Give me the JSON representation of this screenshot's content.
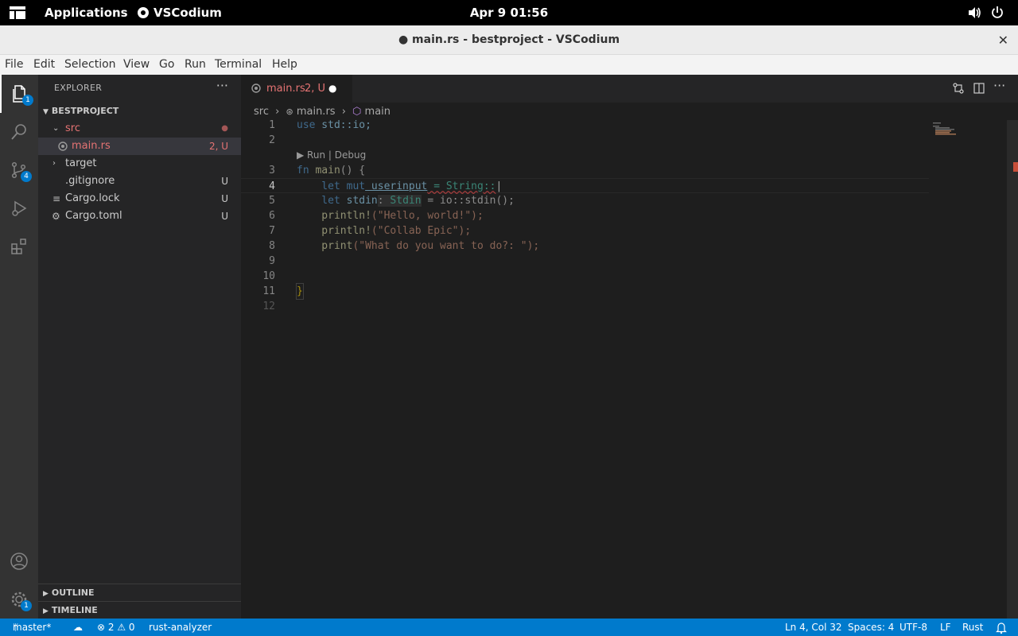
{
  "topbar": {
    "applications": "Applications",
    "app_name": "VSCodium",
    "clock": "Apr 9  01:56"
  },
  "window": {
    "title": "● main.rs - bestproject - VSCodium",
    "close": "✕"
  },
  "menu": [
    "File",
    "Edit",
    "Selection",
    "View",
    "Go",
    "Run",
    "Terminal",
    "Help"
  ],
  "activity": {
    "explorer_badge": "1",
    "scm_badge": "4",
    "settings_badge": "1"
  },
  "sidebar": {
    "title": "EXPLORER",
    "more": "···",
    "project": "BESTPROJECT",
    "tree": [
      {
        "name": "src",
        "status": "●",
        "color": "#e57373"
      },
      {
        "name": "main.rs",
        "status": "2, U",
        "color": "#e57373"
      },
      {
        "name": "target",
        "status": "",
        "color": "#cccccc"
      },
      {
        "name": ".gitignore",
        "status": "U",
        "color": "#cccccc"
      },
      {
        "name": "Cargo.lock",
        "status": "U",
        "color": "#cccccc"
      },
      {
        "name": "Cargo.toml",
        "status": "U",
        "color": "#cccccc"
      }
    ],
    "outline": "OUTLINE",
    "timeline": "TIMELINE"
  },
  "editor": {
    "tab_label": "main.rs",
    "tab_status": "2, U",
    "breadcrumb": {
      "folder": "src",
      "file": "main.rs",
      "symbol": "main"
    },
    "codelens": "▶ Run | Debug",
    "lines": [
      "1",
      "2",
      "3",
      "4",
      "5",
      "6",
      "7",
      "8",
      "9",
      "10",
      "11",
      "12"
    ],
    "code": {
      "l1_kw": "use",
      "l1_rest": " std::io;",
      "l3_kw": "fn",
      "l3_fn": " main",
      "l3_rest": "() {",
      "l4_kw": "    let mut",
      "l4_var": " userinput",
      "l4_rest": " = String::",
      "l5_kw": "    let",
      "l5_var": " stdin",
      "l5_colon": ": ",
      "l5_ty": "Stdin",
      "l5_rest": " = io::stdin();",
      "l6_fn": "    println!",
      "l6_str": "(\"Hello, world!\");",
      "l7_fn": "    println!",
      "l7_str": "(\"Collab Epic\");",
      "l8_fn": "    print",
      "l8_str": "(\"What do you want to do?: \");",
      "l11": "}"
    }
  },
  "statusbar": {
    "branch": "master*",
    "problems": "⊗ 2  ⚠ 0",
    "analyzer": "rust-analyzer",
    "position": "Ln 4, Col 32",
    "spaces": "Spaces: 4",
    "encoding": "UTF-8",
    "eol": "LF",
    "language": "Rust"
  }
}
